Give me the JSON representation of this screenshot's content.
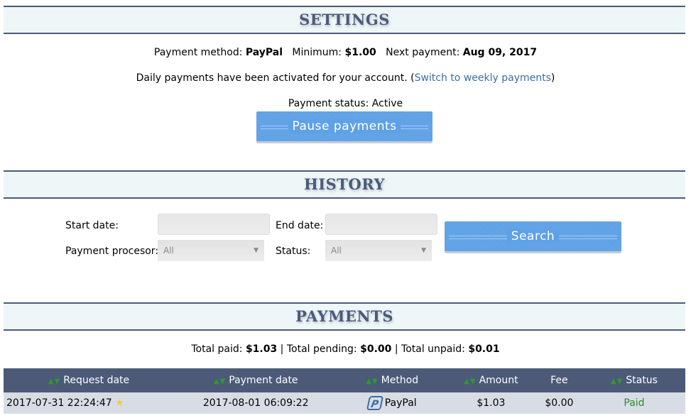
{
  "settings": {
    "title": "SETTINGS",
    "payment_method_label": "Payment method:",
    "payment_method_value": "PayPal",
    "minimum_label": "Minimum:",
    "minimum_value": "$1.00",
    "next_payment_label": "Next payment:",
    "next_payment_value": "Aug 09, 2017",
    "daily_text": "Daily payments have been activated for your account. (",
    "switch_link": "Switch to weekly payments",
    "daily_text_end": ")",
    "status_text": "Payment status: Active",
    "pause_button": "Pause payments"
  },
  "history": {
    "title": "HISTORY",
    "start_date_label": "Start date:",
    "start_date_value": "",
    "end_date_label": "End date:",
    "end_date_value": "",
    "processor_label": "Payment procesor:",
    "processor_value": "All",
    "status_label": "Status:",
    "status_value": "All",
    "search_button": "Search"
  },
  "payments": {
    "title": "PAYMENTS",
    "total_paid_label": "Total paid:",
    "total_paid_value": "$1.03",
    "total_pending_label": "Total pending:",
    "total_pending_value": "$0.00",
    "total_unpaid_label": "Total unpaid:",
    "total_unpaid_value": "$0.01",
    "columns": [
      "Request date",
      "Payment date",
      "Method",
      "Amount",
      "Fee",
      "Status"
    ],
    "rows": [
      {
        "request_date": "2017-07-31 22:24:47",
        "payment_date": "2017-08-01 06:09:22",
        "method": "PayPal",
        "amount": "$1.03",
        "fee": "$0.00",
        "status": "Paid"
      }
    ]
  },
  "colors": {
    "header_bar": "#4c5a78",
    "button": "#5ea1e6",
    "paid_status": "#2a8a2a",
    "link": "#3a6ea5"
  }
}
